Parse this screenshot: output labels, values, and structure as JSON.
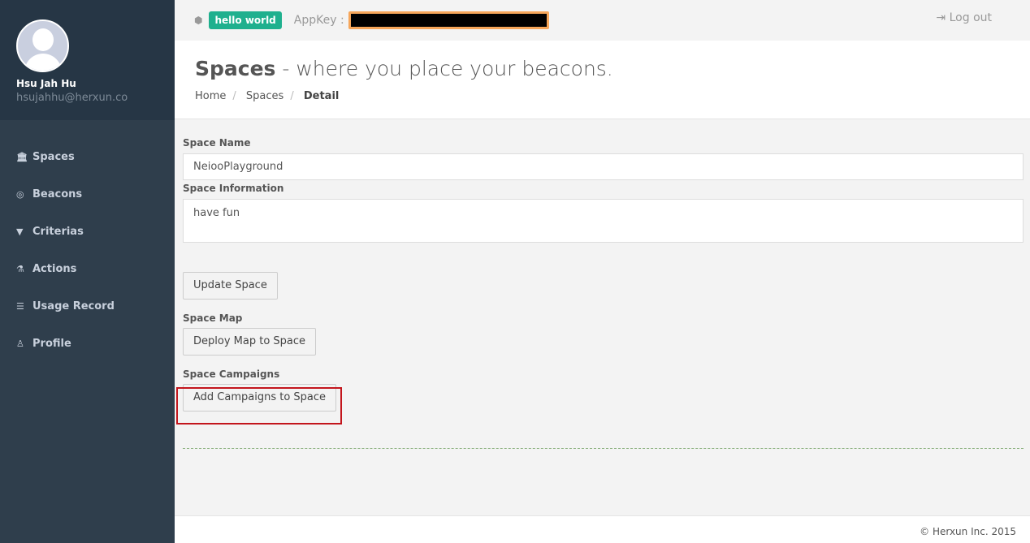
{
  "user": {
    "name": "Hsu Jah Hu",
    "email": "hsujahhu@herxun.co"
  },
  "sidebar": {
    "items": [
      {
        "label": "Spaces",
        "icon": "bank-icon"
      },
      {
        "label": "Beacons",
        "icon": "target-icon"
      },
      {
        "label": "Criterias",
        "icon": "filter-icon"
      },
      {
        "label": "Actions",
        "icon": "flask-icon"
      },
      {
        "label": "Usage Record",
        "icon": "server-icon"
      },
      {
        "label": "Profile",
        "icon": "user-icon"
      }
    ]
  },
  "topbar": {
    "app_badge": "hello world",
    "appkey_label": "AppKey :",
    "logout": "Log out"
  },
  "header": {
    "title_bold": "Spaces",
    "title_rest": " - where you place your beacons.",
    "breadcrumb": [
      "Home",
      "Spaces",
      "Detail"
    ]
  },
  "form": {
    "space_name_label": "Space Name",
    "space_name_value": "NeiooPlayground",
    "space_info_label": "Space Information",
    "space_info_value": "have fun",
    "update_button": "Update Space",
    "map_label": "Space Map",
    "deploy_button": "Deploy Map to Space",
    "campaigns_label": "Space Campaigns",
    "add_campaigns_button": "Add Campaigns to Space"
  },
  "footer": {
    "copyright": "© Herxun Inc. 2015"
  },
  "colors": {
    "sidebar": "#2f3e4c",
    "badge": "#1fb08e",
    "highlight": "#c3151c",
    "appkey_border": "#f6a65a"
  }
}
